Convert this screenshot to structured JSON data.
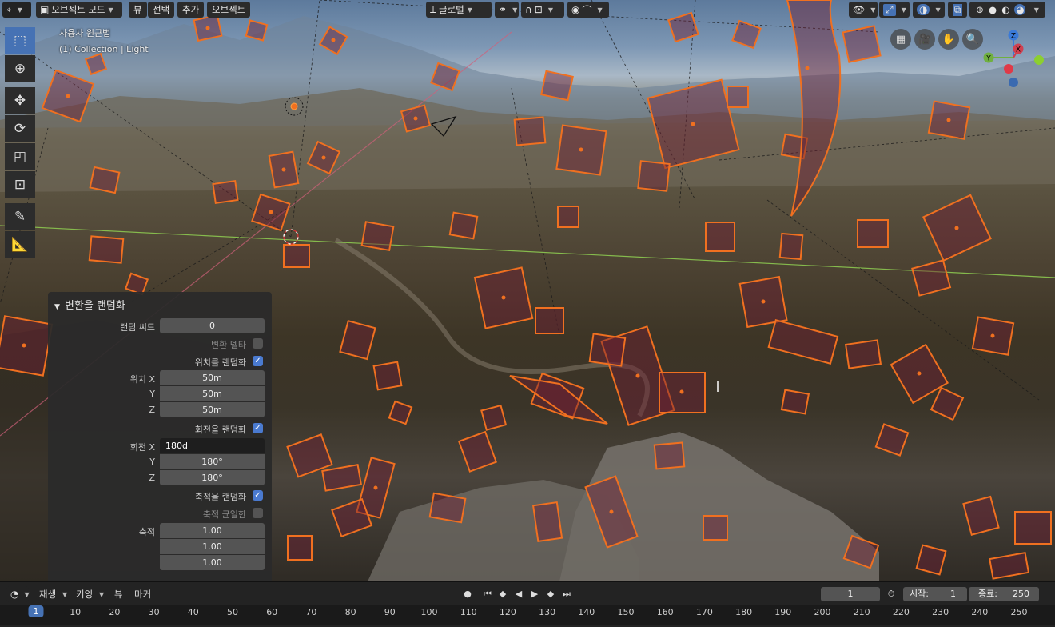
{
  "header": {
    "editor_type_icon": "view3d-icon",
    "mode": "오브젝트 모드",
    "menus": [
      "뷰",
      "선택",
      "추가",
      "오브젝트"
    ],
    "orientation": "글로벌"
  },
  "viewport": {
    "view_name": "사용자 원근법",
    "collection": "(1) Collection | Light",
    "gizmo_axes": {
      "z": "Z",
      "y": "Y",
      "x": "X"
    }
  },
  "redo_panel": {
    "title": "변환을 랜덤화",
    "random_seed_label": "랜덤 씨드",
    "random_seed_value": "0",
    "transform_delta_label": "변환 델타",
    "transform_delta_checked": false,
    "randomize_location_label": "위치를 랜덤화",
    "randomize_location_checked": true,
    "location_label": "위치",
    "location": {
      "x_label": "X",
      "x": "50m",
      "y_label": "Y",
      "y": "50m",
      "z_label": "Z",
      "z": "50m"
    },
    "randomize_rotation_label": "회전을 랜덤화",
    "randomize_rotation_checked": true,
    "rotation_label": "회전",
    "rotation": {
      "x_label": "X",
      "x": "180d",
      "y_label": "Y",
      "y": "180°",
      "z_label": "Z",
      "z": "180°"
    },
    "randomize_scale_label": "축적을 랜덤화",
    "randomize_scale_checked": true,
    "scale_even_label": "축적 균일한",
    "scale_even_checked": false,
    "scale_label": "축적",
    "scale": {
      "x": "1.00",
      "y": "1.00",
      "z": "1.00"
    }
  },
  "timeline": {
    "menus": [
      "재생",
      "키잉",
      "뷰",
      "마커"
    ],
    "current_frame": "1",
    "start_label": "시작:",
    "start": "1",
    "end_label": "종료:",
    "end": "250",
    "ruler_ticks": [
      "1",
      "10",
      "20",
      "30",
      "40",
      "50",
      "60",
      "70",
      "80",
      "90",
      "100",
      "110",
      "120",
      "130",
      "140",
      "150",
      "160",
      "170",
      "180",
      "190",
      "200",
      "210",
      "220",
      "230",
      "240",
      "250"
    ]
  },
  "colors": {
    "accent": "#4672b4",
    "selection_outline": "#f07020",
    "panel_bg": "#2a2a2a"
  }
}
